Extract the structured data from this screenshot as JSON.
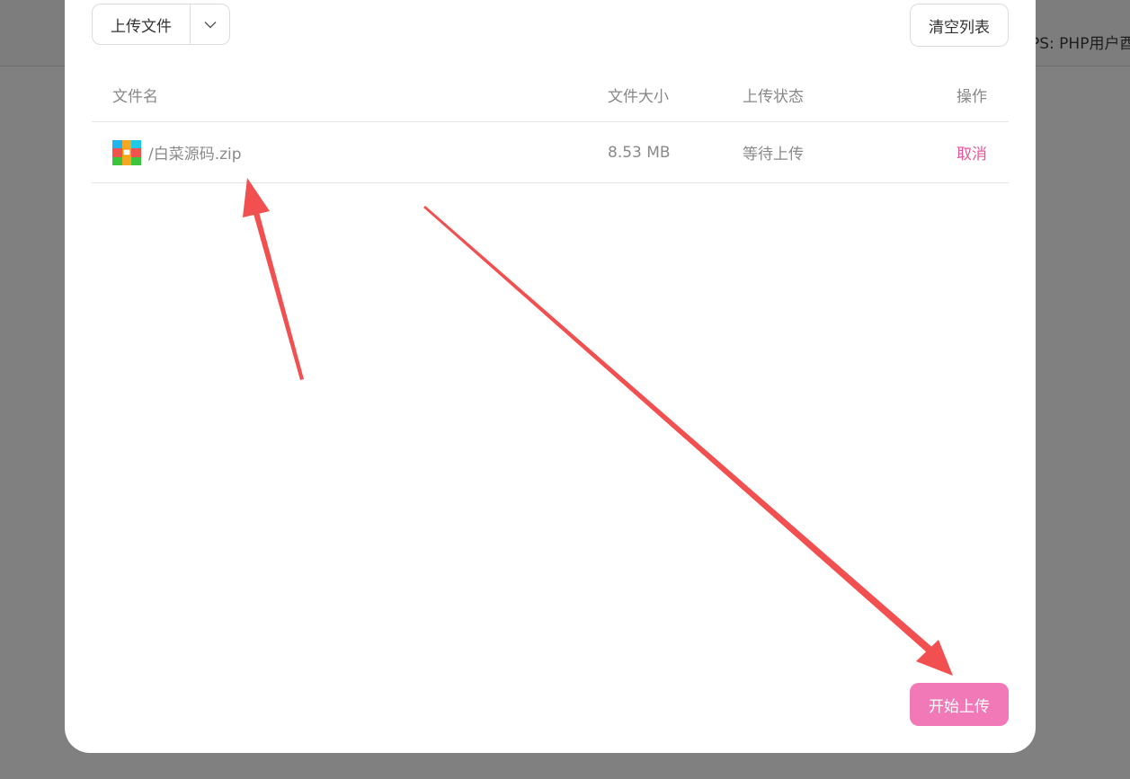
{
  "background": {
    "partial_text": "PS: PHP用户酉"
  },
  "toolbar": {
    "upload_label": "上传文件",
    "clear_label": "清空列表"
  },
  "table": {
    "headers": {
      "name": "文件名",
      "size": "文件大小",
      "status": "上传状态",
      "action": "操作"
    },
    "rows": [
      {
        "icon": "zip-archive-icon",
        "name": "/白菜源码.zip",
        "size": "8.53 MB",
        "status": "等待上传",
        "action": "取消"
      }
    ]
  },
  "footer": {
    "start_label": "开始上传"
  },
  "colors": {
    "accent": "#f279b7",
    "cancel_link": "#e8559b",
    "annotation_arrow": "#f25050",
    "overlay": "#808080"
  }
}
